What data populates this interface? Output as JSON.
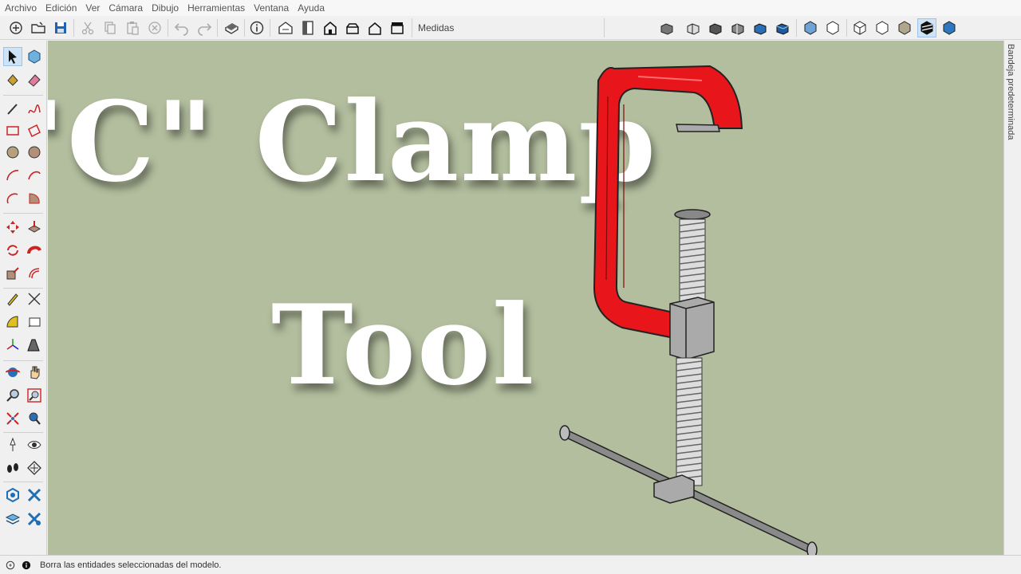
{
  "menu": [
    "Archivo",
    "Edición",
    "Ver",
    "Cámara",
    "Dibujo",
    "Herramientas",
    "Ventana",
    "Ayuda"
  ],
  "toolbar": {
    "measures_label": "Medidas"
  },
  "viewport": {
    "title_line1": "\"C\" Clamp",
    "title_line2": "Tool",
    "background_color": "#b3be9e",
    "clamp_color": "#e8161b"
  },
  "tray": {
    "label": "Bandeja predeterminada"
  },
  "status": {
    "text": "Borra las entidades seleccionadas del modelo."
  }
}
